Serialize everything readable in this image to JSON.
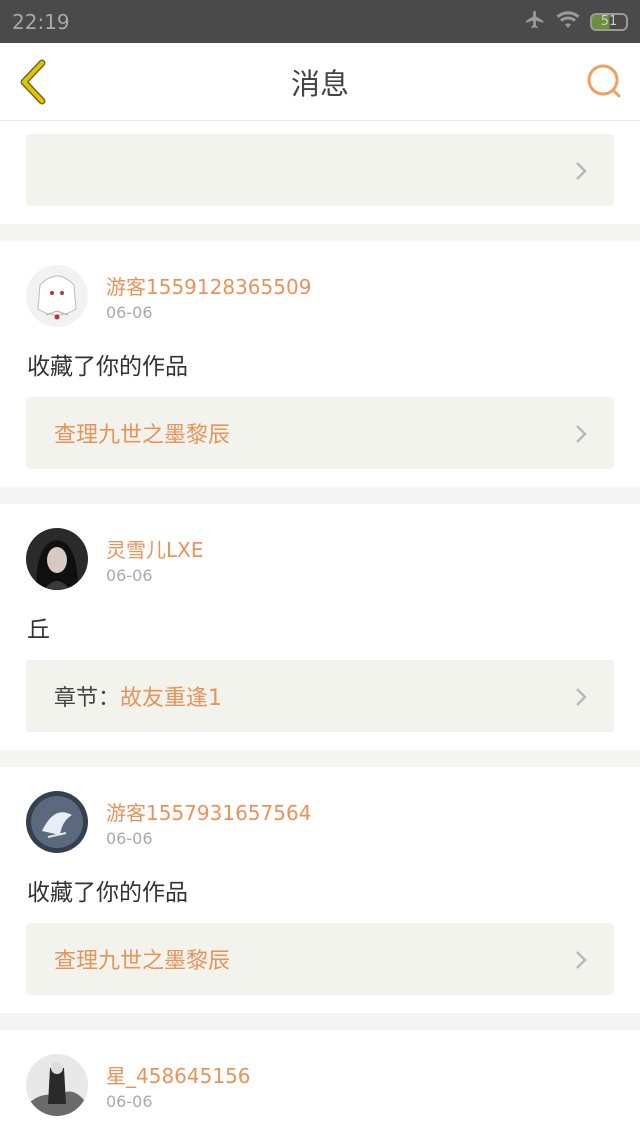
{
  "status": {
    "time": "22:19",
    "battery": "51"
  },
  "header": {
    "title": "消息"
  },
  "top_box": {
    "text": ""
  },
  "messages": [
    {
      "username": "游客1559128365509",
      "date": "06-06",
      "text": "收藏了你的作品",
      "link_prefix": "",
      "link_text": "查理九世之墨黎辰"
    },
    {
      "username": "灵雪儿LXE",
      "date": "06-06",
      "text": "丘",
      "link_prefix": "章节：",
      "link_text": "故友重逢1"
    },
    {
      "username": "游客1557931657564",
      "date": "06-06",
      "text": "收藏了你的作品",
      "link_prefix": "",
      "link_text": "查理九世之墨黎辰"
    },
    {
      "username": "星_458645156",
      "date": "06-06",
      "text": "",
      "link_prefix": "",
      "link_text": ""
    }
  ],
  "colors": {
    "accent": "#e8935a",
    "back_arrow": "#e6c200"
  }
}
